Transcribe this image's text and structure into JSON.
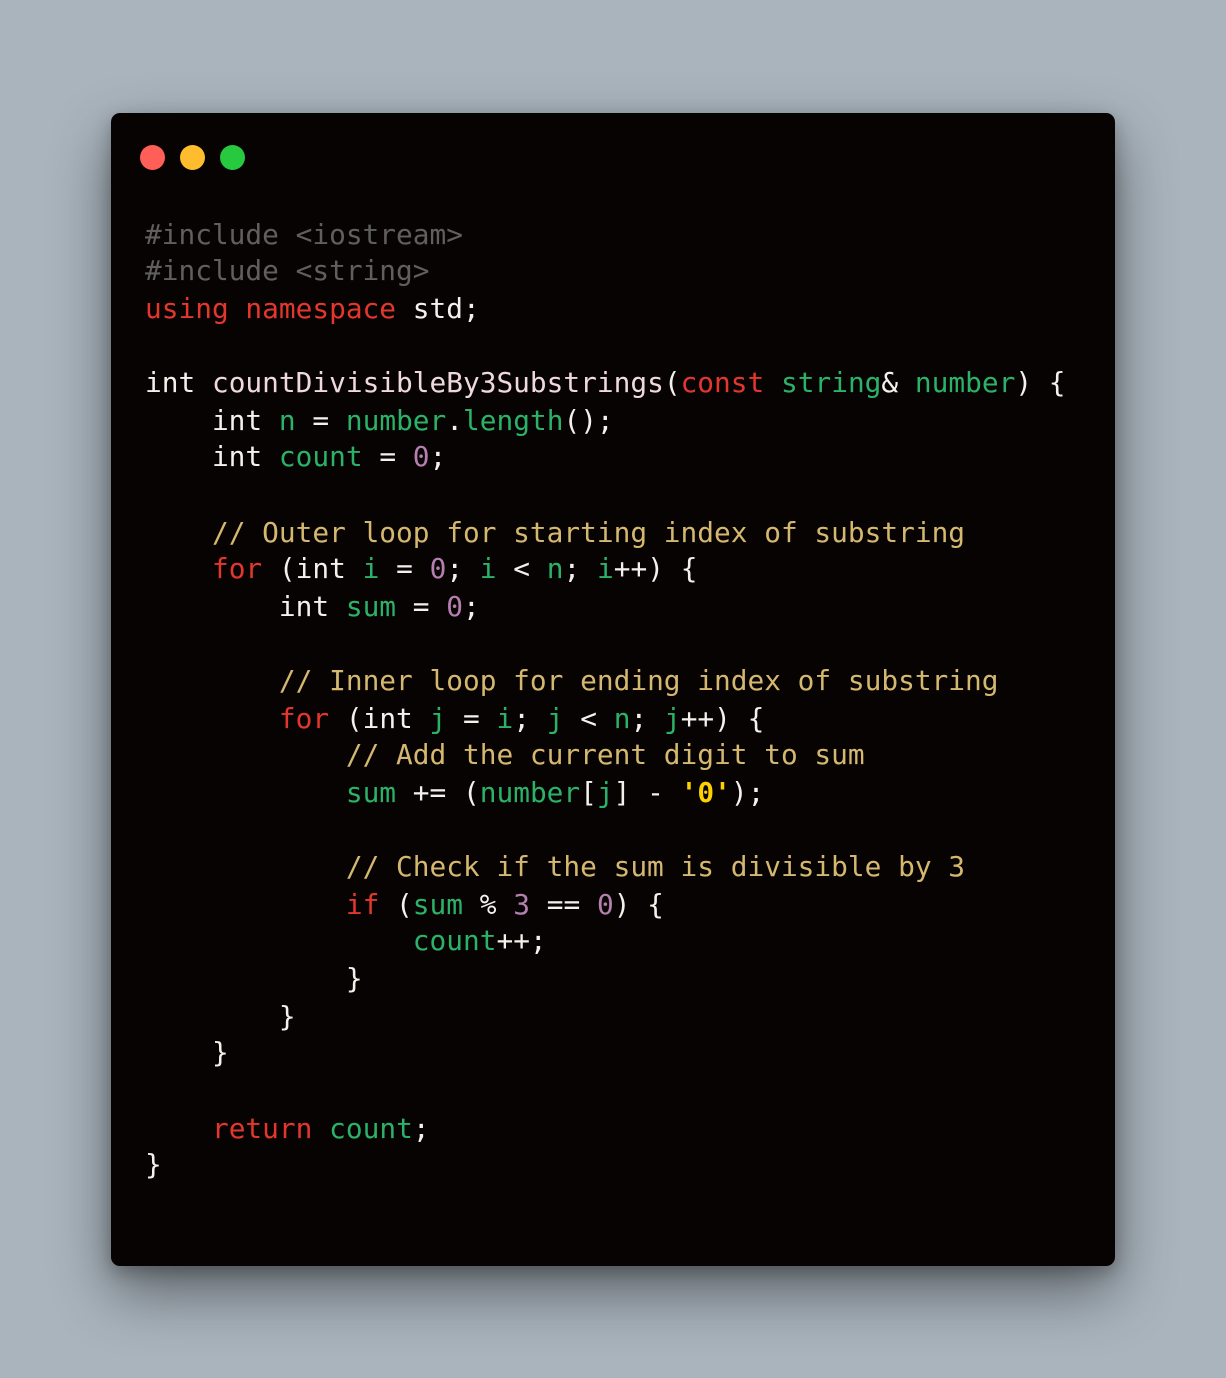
{
  "window": {
    "controls": [
      "close",
      "minimize",
      "maximize"
    ],
    "colors": {
      "background": "#070302",
      "close": "#ff5f56",
      "minimize": "#ffbd2e",
      "maximize": "#27c93f"
    }
  },
  "syntax_colors": {
    "preprocessor": "#5f5f5f",
    "keyword": "#e3372e",
    "variable": "#2bb267",
    "number": "#b57fb0",
    "comment": "#d4b86f",
    "string": "#ffd000",
    "plain": "#f4f0ec"
  },
  "code": {
    "language": "C++",
    "lines": [
      [
        [
          "pp",
          "#include <iostream>"
        ]
      ],
      [
        [
          "pp",
          "#include <string>"
        ]
      ],
      [
        [
          "kw",
          "using namespace"
        ],
        [
          "pl",
          " std;"
        ]
      ],
      [],
      [
        [
          "ty",
          "int "
        ],
        [
          "fn",
          "countDivisibleBy3Substrings"
        ],
        [
          "pl",
          "("
        ],
        [
          "kw",
          "const"
        ],
        [
          "pl",
          " "
        ],
        [
          "var",
          "string"
        ],
        [
          "pl",
          "& "
        ],
        [
          "var",
          "number"
        ],
        [
          "pl",
          ") {"
        ]
      ],
      [
        [
          "pl",
          "    int "
        ],
        [
          "var",
          "n"
        ],
        [
          "pl",
          " = "
        ],
        [
          "var",
          "number"
        ],
        [
          "pl",
          "."
        ],
        [
          "var",
          "length"
        ],
        [
          "pl",
          "();"
        ]
      ],
      [
        [
          "pl",
          "    int "
        ],
        [
          "var",
          "count"
        ],
        [
          "pl",
          " = "
        ],
        [
          "num",
          "0"
        ],
        [
          "pl",
          ";"
        ]
      ],
      [],
      [
        [
          "pl",
          "    "
        ],
        [
          "cm",
          "// Outer loop for starting index of substring"
        ]
      ],
      [
        [
          "pl",
          "    "
        ],
        [
          "kw",
          "for"
        ],
        [
          "pl",
          " (int "
        ],
        [
          "var",
          "i"
        ],
        [
          "pl",
          " = "
        ],
        [
          "num",
          "0"
        ],
        [
          "pl",
          "; "
        ],
        [
          "var",
          "i"
        ],
        [
          "pl",
          " < "
        ],
        [
          "var",
          "n"
        ],
        [
          "pl",
          "; "
        ],
        [
          "var",
          "i"
        ],
        [
          "pl",
          "++) {"
        ]
      ],
      [
        [
          "pl",
          "        int "
        ],
        [
          "var",
          "sum"
        ],
        [
          "pl",
          " = "
        ],
        [
          "num",
          "0"
        ],
        [
          "pl",
          ";"
        ]
      ],
      [],
      [
        [
          "pl",
          "        "
        ],
        [
          "cm",
          "// Inner loop for ending index of substring"
        ]
      ],
      [
        [
          "pl",
          "        "
        ],
        [
          "kw",
          "for"
        ],
        [
          "pl",
          " (int "
        ],
        [
          "var",
          "j"
        ],
        [
          "pl",
          " = "
        ],
        [
          "var",
          "i"
        ],
        [
          "pl",
          "; "
        ],
        [
          "var",
          "j"
        ],
        [
          "pl",
          " < "
        ],
        [
          "var",
          "n"
        ],
        [
          "pl",
          "; "
        ],
        [
          "var",
          "j"
        ],
        [
          "pl",
          "++) {"
        ]
      ],
      [
        [
          "pl",
          "            "
        ],
        [
          "cm",
          "// Add the current digit to sum"
        ]
      ],
      [
        [
          "pl",
          "            "
        ],
        [
          "var",
          "sum"
        ],
        [
          "pl",
          " += ("
        ],
        [
          "var",
          "number"
        ],
        [
          "pl",
          "["
        ],
        [
          "var",
          "j"
        ],
        [
          "pl",
          "] - "
        ],
        [
          "str",
          "'0'"
        ],
        [
          "pl",
          ");"
        ]
      ],
      [],
      [
        [
          "pl",
          "            "
        ],
        [
          "cm",
          "// Check if the sum is divisible by 3"
        ]
      ],
      [
        [
          "pl",
          "            "
        ],
        [
          "kw",
          "if"
        ],
        [
          "pl",
          " ("
        ],
        [
          "var",
          "sum"
        ],
        [
          "pl",
          " % "
        ],
        [
          "num",
          "3"
        ],
        [
          "pl",
          " == "
        ],
        [
          "num",
          "0"
        ],
        [
          "pl",
          ") {"
        ]
      ],
      [
        [
          "pl",
          "                "
        ],
        [
          "var",
          "count"
        ],
        [
          "pl",
          "++;"
        ]
      ],
      [
        [
          "pl",
          "            }"
        ]
      ],
      [
        [
          "pl",
          "        }"
        ]
      ],
      [
        [
          "pl",
          "    }"
        ]
      ],
      [],
      [
        [
          "pl",
          "    "
        ],
        [
          "kw",
          "return"
        ],
        [
          "pl",
          " "
        ],
        [
          "var",
          "count"
        ],
        [
          "pl",
          ";"
        ]
      ],
      [
        [
          "pl",
          "}"
        ]
      ]
    ]
  }
}
